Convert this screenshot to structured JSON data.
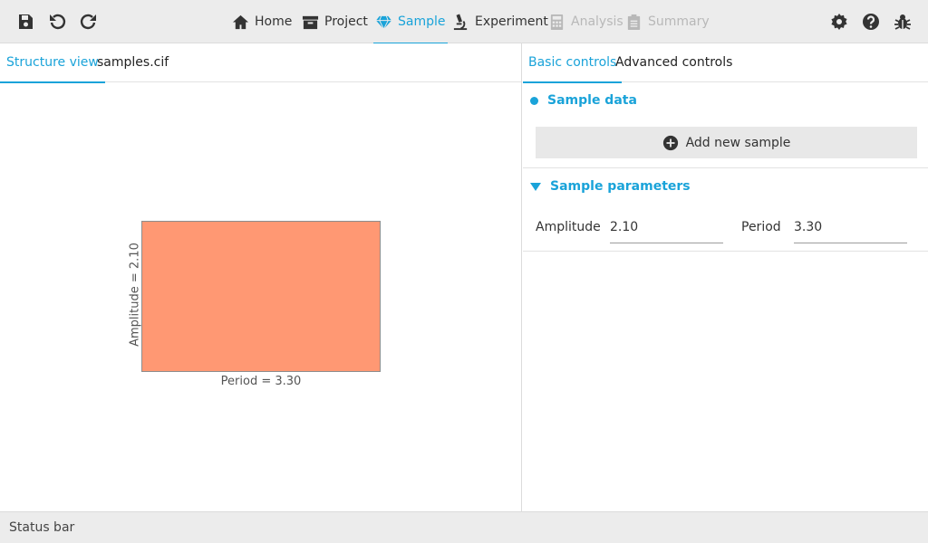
{
  "toolbar": {
    "left_icons": [
      "save-icon",
      "undo-icon",
      "redo-icon"
    ],
    "right_icons": [
      "gear-icon",
      "help-icon",
      "bug-icon"
    ]
  },
  "nav": {
    "tabs": [
      {
        "label": "Home",
        "icon": "home-icon",
        "state": "normal"
      },
      {
        "label": "Project",
        "icon": "archive-icon",
        "state": "normal"
      },
      {
        "label": "Sample",
        "icon": "gem-icon",
        "state": "active"
      },
      {
        "label": "Experiment",
        "icon": "microscope-icon",
        "state": "normal"
      },
      {
        "label": "Analysis",
        "icon": "calculator-icon",
        "state": "disabled"
      },
      {
        "label": "Summary",
        "icon": "clipboard-icon",
        "state": "disabled"
      }
    ]
  },
  "left_panel": {
    "tabs": [
      {
        "label": "Structure view",
        "active": true
      },
      {
        "label": "samples.cif",
        "active": false
      }
    ],
    "structure": {
      "x_label": "Period = 3.30",
      "y_label": "Amplitude = 2.10",
      "fill_color": "#ff9873"
    }
  },
  "right_panel": {
    "tabs": [
      {
        "label": "Basic controls",
        "active": true
      },
      {
        "label": "Advanced controls",
        "active": false
      }
    ],
    "sample_data": {
      "title": "Sample data",
      "add_button_label": "Add new sample"
    },
    "sample_parameters": {
      "title": "Sample parameters",
      "amplitude_label": "Amplitude",
      "amplitude_value": "2.10",
      "period_label": "Period",
      "period_value": "3.30"
    }
  },
  "status_bar": {
    "text": "Status bar"
  },
  "colors": {
    "accent": "#1aa3d9",
    "toolbar_bg": "#ececec",
    "disabled": "#b8b8b8"
  }
}
